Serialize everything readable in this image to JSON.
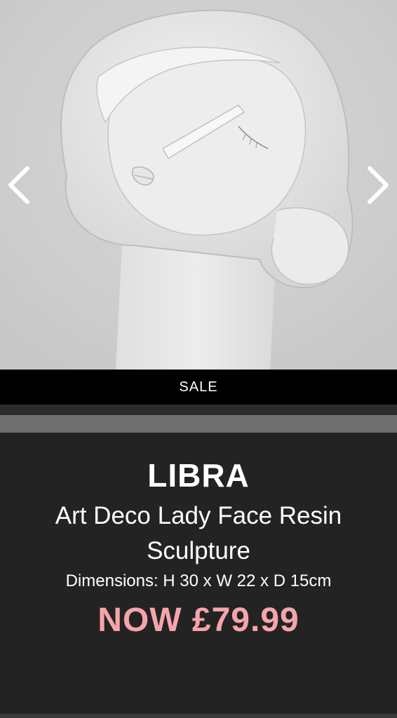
{
  "gallery": {
    "image_alt": "Art Deco lady face sculpture",
    "prev_icon": "chevron-left-icon",
    "next_icon": "chevron-right-icon"
  },
  "sale_banner": {
    "label": "SALE"
  },
  "product": {
    "brand": "LIBRA",
    "name": "Art Deco Lady Face Resin Sculpture",
    "dimensions": "Dimensions: H 30 x W 22 x D 15cm",
    "price": "NOW £79.99",
    "price_color": "#f5a5aa"
  },
  "colors": {
    "background": "#232323",
    "sale_bar": "#000000",
    "accent_grey": "#6f6f6f"
  }
}
